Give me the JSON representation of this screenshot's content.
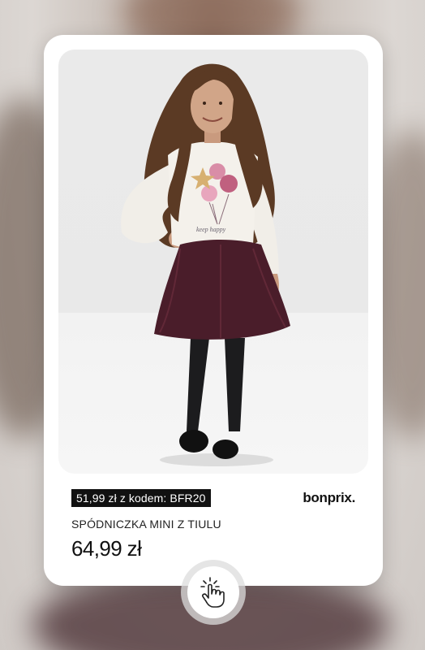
{
  "product_card": {
    "promo": "51,99 zł z kodem: BFR20",
    "brand": "bonprix.",
    "name": "SPÓDNICZKA MINI Z TIULU",
    "price": "64,99 zł"
  },
  "icons": {
    "tap": "hand-tap-icon"
  }
}
